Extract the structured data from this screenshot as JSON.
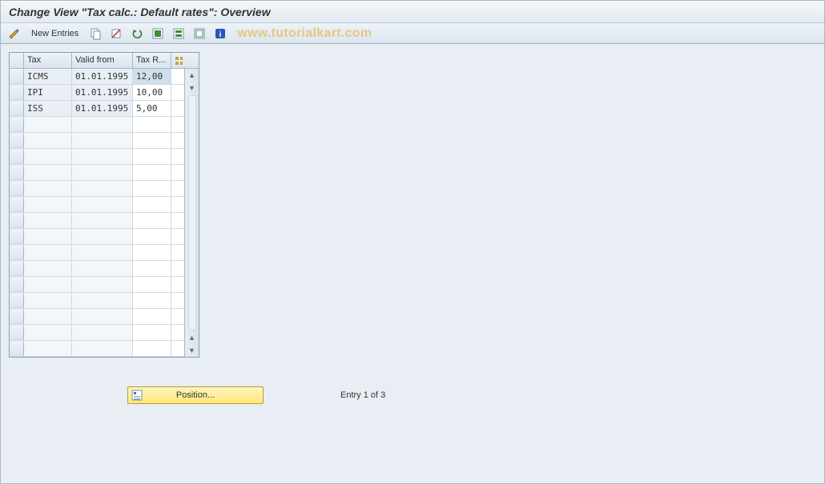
{
  "title": "Change View \"Tax calc.: Default rates\": Overview",
  "toolbar": {
    "new_entries_label": "New Entries"
  },
  "watermark": "www.tutorialkart.com",
  "table": {
    "columns": {
      "tax": "Tax",
      "valid_from": "Valid from",
      "tax_rate": "Tax R..."
    },
    "rows": [
      {
        "tax": "ICMS",
        "valid_from": "01.01.1995",
        "rate": "12,00",
        "selected": true
      },
      {
        "tax": "IPI",
        "valid_from": "01.01.1995",
        "rate": "10,00",
        "selected": false
      },
      {
        "tax": "ISS",
        "valid_from": "01.01.1995",
        "rate": "5,00",
        "selected": false
      }
    ],
    "empty_row_count": 15
  },
  "footer": {
    "position_label": "Position...",
    "entry_label": "Entry 1 of 3"
  }
}
